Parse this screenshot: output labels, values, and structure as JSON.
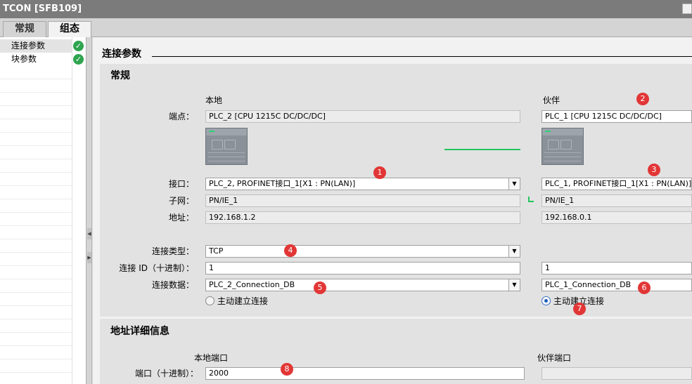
{
  "window": {
    "title": "TCON [SFB109]"
  },
  "tabs": [
    {
      "label": "常规"
    },
    {
      "label": "组态"
    }
  ],
  "nav": {
    "items": [
      {
        "label": "连接参数",
        "status": "ok"
      },
      {
        "label": "块参数",
        "status": "ok"
      }
    ]
  },
  "section": {
    "title": "连接参数",
    "general": {
      "title": "常规",
      "local_header": "本地",
      "partner_header": "伙伴",
      "labels": {
        "endpoint": "端点：",
        "interface": "接口：",
        "subnet": "子网：",
        "address": "地址：",
        "conn_type": "连接类型：",
        "conn_id": "连接 ID（十进制）：",
        "conn_data": "连接数据："
      },
      "local": {
        "endpoint": "PLC_2 [CPU 1215C DC/DC/DC]",
        "interface": "PLC_2, PROFINET接口_1[X1 : PN(LAN)]",
        "subnet": "PN/IE_1",
        "address": "192.168.1.2",
        "conn_type": "TCP",
        "conn_id": "1",
        "conn_data": "PLC_2_Connection_DB",
        "active_label": "主动建立连接",
        "active_selected": false
      },
      "partner": {
        "endpoint": "PLC_1 [CPU 1215C DC/DC/DC]",
        "interface": "PLC_1, PROFINET接口_1[X1 : PN(LAN)]",
        "subnet": "PN/IE_1",
        "address": "192.168.0.1",
        "conn_id": "1",
        "conn_data": "PLC_1_Connection_DB",
        "active_label": "主动建立连接",
        "active_selected": true
      }
    },
    "address_details": {
      "title": "地址详细信息",
      "local_port_header": "本地端口",
      "partner_port_header": "伙伴端口",
      "port_label": "端口（十进制）：",
      "local_port": "2000",
      "partner_port": ""
    }
  },
  "callouts": [
    "1",
    "2",
    "3",
    "4",
    "5",
    "6",
    "7",
    "8"
  ],
  "colors": {
    "callout": "#e23636",
    "ok": "#2ea44f",
    "link": "#22c55e",
    "accent": "#1b5cb8"
  }
}
